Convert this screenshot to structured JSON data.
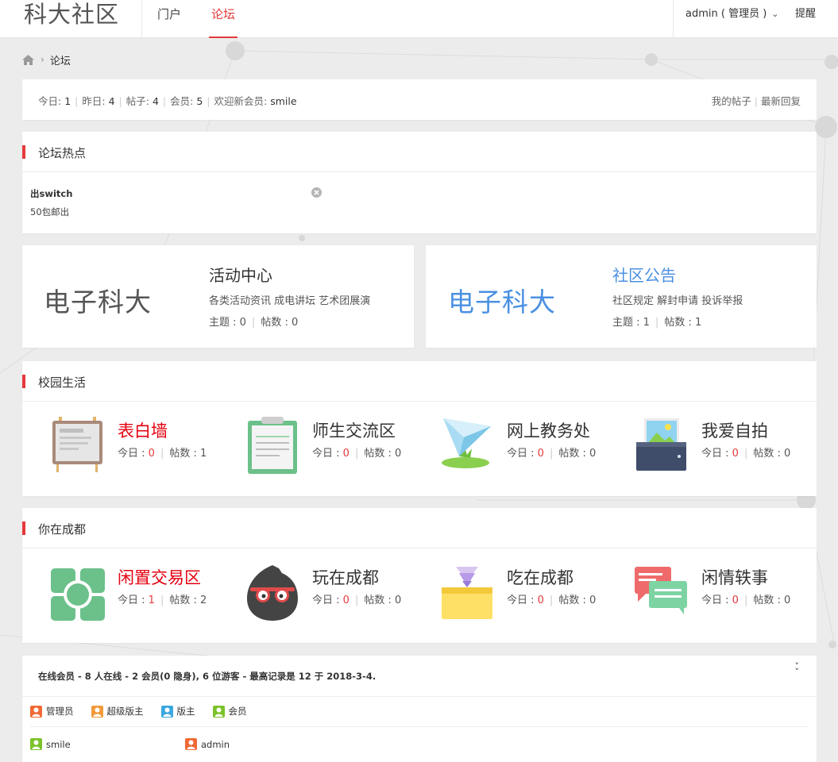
{
  "header": {
    "logo": "科大社区",
    "nav": [
      {
        "label": "门户",
        "active": false
      },
      {
        "label": "论坛",
        "active": true
      }
    ],
    "user": "admin ( 管理员 )",
    "remind": "提醒"
  },
  "breadcrumb": {
    "home_icon": "home-icon",
    "current": "论坛"
  },
  "stats": {
    "today_label": "今日:",
    "today": "1",
    "yesterday_label": "昨日:",
    "yesterday": "4",
    "posts_label": "帖子:",
    "posts": "4",
    "members_label": "会员:",
    "members": "5",
    "welcome_label": "欢迎新会员:",
    "newest_member": "smile",
    "my_posts": "我的帖子",
    "latest_replies": "最新回复"
  },
  "hot": {
    "title": "论坛热点",
    "item": {
      "title": "出switch",
      "desc": "50包邮出"
    }
  },
  "cards": [
    {
      "logo": "电子科大",
      "title": "活动中心",
      "desc": "各类活动资讯 成电讲坛 艺术团展演",
      "topics": "主题 : 0",
      "posts": "帖数 : 0",
      "logo_color": "#555555",
      "title_color": "#333333"
    },
    {
      "logo": "电子科大",
      "title": "社区公告",
      "desc": "社区规定 解封申请 投诉举报",
      "topics": "主题 : 1",
      "posts": "帖数 : 1",
      "logo_color": "#4a90e2",
      "title_color": "#4a90e2"
    }
  ],
  "section1": {
    "title": "校园生活",
    "forums": [
      {
        "name": "表白墙",
        "today_label": "今日 : ",
        "today": "0",
        "posts": "帖数 : 1",
        "icon": "easel-icon",
        "highlight": true
      },
      {
        "name": "师生交流区",
        "today_label": "今日 : ",
        "today": "0",
        "posts": "帖数 : 0",
        "icon": "clipboard-icon",
        "highlight": false
      },
      {
        "name": "网上教务处",
        "today_label": "今日 : ",
        "today": "0",
        "posts": "帖数 : 0",
        "icon": "paper-plane-icon",
        "highlight": false
      },
      {
        "name": "我爱自拍",
        "today_label": "今日 : ",
        "today": "0",
        "posts": "帖数 : 0",
        "icon": "photo-icon",
        "highlight": false
      }
    ]
  },
  "section2": {
    "title": "你在成都",
    "forums": [
      {
        "name": "闲置交易区",
        "today_label": "今日 : ",
        "today": "1",
        "posts": "帖数 : 2",
        "icon": "trade-icon",
        "highlight": true
      },
      {
        "name": "玩在成都",
        "today_label": "今日 : ",
        "today": "0",
        "posts": "帖数 : 0",
        "icon": "ninja-icon",
        "highlight": false
      },
      {
        "name": "吃在成都",
        "today_label": "今日 : ",
        "today": "0",
        "posts": "帖数 : 0",
        "icon": "food-box-icon",
        "highlight": false
      },
      {
        "name": "闲情轶事",
        "today_label": "今日 : ",
        "today": "0",
        "posts": "帖数 : 0",
        "icon": "chat-bubbles-icon",
        "highlight": false
      }
    ]
  },
  "online": {
    "summary": "在线会员 - 8 人在线 - 2 会员(0 隐身), 6 位游客 - 最高记录是 12 于 2018-3-4.",
    "toggle_icon": "double-chevron-down-icon",
    "legend": [
      {
        "label": "管理员",
        "color": "#f06a35"
      },
      {
        "label": "超级版主",
        "color": "#f39a3a"
      },
      {
        "label": "版主",
        "color": "#3aa7e0"
      },
      {
        "label": "会员",
        "color": "#7cc22b"
      }
    ],
    "members": [
      {
        "name": "smile",
        "color": "#7cc22b"
      },
      {
        "name": "admin",
        "color": "#f06a35"
      }
    ]
  },
  "colors": {
    "accent": "#e4393c",
    "blue": "#4a90e2",
    "background": "#ececec"
  }
}
